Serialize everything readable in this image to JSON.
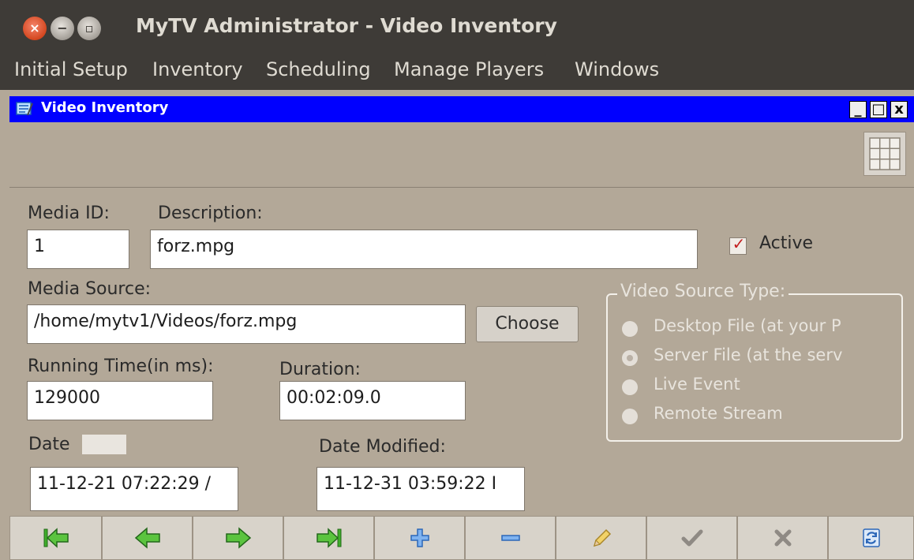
{
  "window": {
    "title": "MyTV Administrator - Video Inventory",
    "close_glyph": "×",
    "min_glyph": "−",
    "max_glyph": "▫"
  },
  "menu": [
    "Initial Setup",
    "Inventory",
    "Scheduling",
    "Manage Players",
    "Windows"
  ],
  "internal_frame": {
    "title": "Video Inventory",
    "min_glyph": "_",
    "max_glyph": "□",
    "close_glyph": "x"
  },
  "form": {
    "media_id_label": "Media ID:",
    "media_id_value": "1",
    "description_label": "Description:",
    "description_value": "forz.mpg",
    "active_label": "Active",
    "active_checked": true,
    "media_source_label": "Media Source:",
    "media_source_value": "/home/mytv1/Videos/forz.mpg",
    "choose_label": "Choose",
    "running_time_label": "Running Time(in ms):",
    "running_time_value": "129000",
    "duration_label": "Duration:",
    "duration_value": "00:02:09.0",
    "date_label": "Date",
    "date_value": "11-12-21 07:22:29 /",
    "date_modified_label": "Date Modified:",
    "date_modified_value": "11-12-31 03:59:22 I"
  },
  "video_source_type": {
    "legend": "Video Source Type:",
    "options": [
      "Desktop File (at your P",
      "Server File (at the serv",
      "Live Event",
      "Remote Stream"
    ],
    "selected": "Server File (at the serv"
  },
  "nav_buttons": [
    "first-icon",
    "previous-icon",
    "next-icon",
    "last-icon",
    "add-icon",
    "delete-icon",
    "edit-icon",
    "confirm-icon",
    "cancel-icon",
    "refresh-icon"
  ],
  "colors": {
    "title_bar": "#3e3b37",
    "frame_title": "#0000ff",
    "background": "#b3a898",
    "check_mark": "#c31f1f",
    "nav_green": "#3fae2a",
    "nav_blue": "#3c7fd6"
  }
}
